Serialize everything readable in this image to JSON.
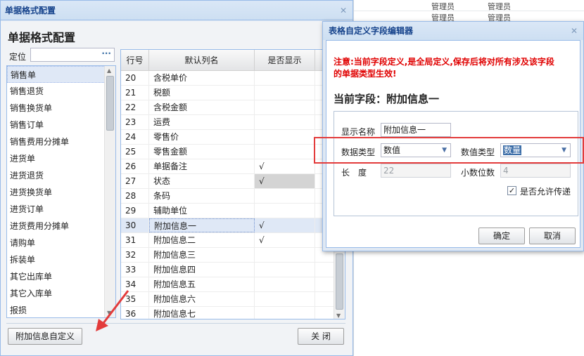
{
  "background_grid": {
    "rows": [
      {
        "a": "管理员",
        "b": "管理员"
      },
      {
        "a": "管理员",
        "b": "管理员"
      }
    ]
  },
  "main_window": {
    "title": "单据格式配置",
    "heading": "单据格式配置",
    "locate_label": "定位",
    "locate_value": "",
    "locate_dots": "···",
    "doc_types": [
      "销售单",
      "销售退货",
      "销售换货单",
      "销售订单",
      "销售费用分摊单",
      "进货单",
      "进货退货",
      "进货换货单",
      "进货订单",
      "进货费用分摊单",
      "请购单",
      "拆装单",
      "其它出库单",
      "其它入库单",
      "报损"
    ],
    "selected_doc_type_index": 0,
    "grid": {
      "headers": {
        "row_no": "行号",
        "default_name": "默认列名",
        "show": "是否显示"
      },
      "rows": [
        {
          "no": "20",
          "name": "含税单价",
          "show": ""
        },
        {
          "no": "21",
          "name": "税额",
          "show": ""
        },
        {
          "no": "22",
          "name": "含税金额",
          "show": ""
        },
        {
          "no": "23",
          "name": "运费",
          "show": ""
        },
        {
          "no": "24",
          "name": "零售价",
          "show": ""
        },
        {
          "no": "25",
          "name": "零售金额",
          "show": ""
        },
        {
          "no": "26",
          "name": "单据备注",
          "show": "√"
        },
        {
          "no": "27",
          "name": "状态",
          "show": "√"
        },
        {
          "no": "28",
          "name": "条码",
          "show": ""
        },
        {
          "no": "29",
          "name": "辅助单位",
          "show": ""
        },
        {
          "no": "30",
          "name": "附加信息一",
          "show": "√"
        },
        {
          "no": "31",
          "name": "附加信息二",
          "show": "√"
        },
        {
          "no": "32",
          "name": "附加信息三",
          "show": ""
        },
        {
          "no": "33",
          "name": "附加信息四",
          "show": ""
        },
        {
          "no": "34",
          "name": "附加信息五",
          "show": ""
        },
        {
          "no": "35",
          "name": "附加信息六",
          "show": ""
        },
        {
          "no": "36",
          "name": "附加信息七",
          "show": ""
        }
      ],
      "selected_row_no": "30"
    },
    "buttons": {
      "custom_extra": "附加信息自定义",
      "close": "关 闭"
    }
  },
  "dialog": {
    "title": "表格自定义字段编辑器",
    "warning": "注意:当前字段定义,是全局定义,保存后将对所有涉及该字段的单据类型生效!",
    "current_field": "当前字段：附加信息一",
    "display_name_label": "显示名称",
    "display_name_value": "附加信息一",
    "data_type_label": "数据类型",
    "data_type_value": "数值",
    "value_type_label": "数值类型",
    "value_type_value": "数量",
    "length_label": "长　度",
    "length_value": "22",
    "decimals_label": "小数位数",
    "decimals_value": "4",
    "allow_pass_label": "是否允许传递",
    "allow_pass_checked": true,
    "ok_label": "确定",
    "cancel_label": "取消"
  },
  "colors": {
    "warning": "#e00000",
    "annotation": "#e33b3b",
    "title_text": "#15428b"
  }
}
